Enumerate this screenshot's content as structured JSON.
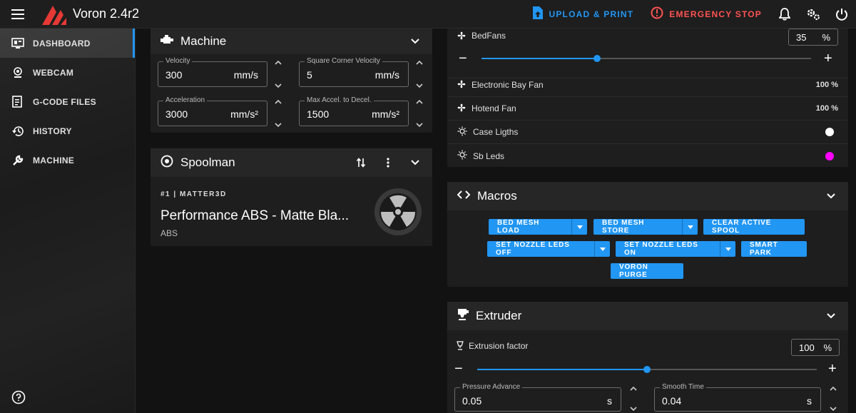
{
  "app": {
    "title": "Voron 2.4r2"
  },
  "topbar": {
    "upload_label": "UPLOAD & PRINT",
    "estop_label": "EMERGENCY STOP"
  },
  "sidebar": {
    "items": [
      {
        "label": "DASHBOARD",
        "icon": "monitor-dashboard-icon"
      },
      {
        "label": "WEBCAM",
        "icon": "webcam-icon"
      },
      {
        "label": "G-CODE FILES",
        "icon": "file-document-icon"
      },
      {
        "label": "HISTORY",
        "icon": "history-icon"
      },
      {
        "label": "MACHINE",
        "icon": "wrench-icon"
      }
    ]
  },
  "machine": {
    "title": "Machine",
    "velocity": {
      "label": "Velocity",
      "value": "300",
      "unit": "mm/s"
    },
    "scv": {
      "label": "Square Corner Velocity",
      "value": "5",
      "unit": "mm/s"
    },
    "accel": {
      "label": "Acceleration",
      "value": "3000",
      "unit": "mm/s²"
    },
    "decel": {
      "label": "Max Accel. to Decel.",
      "value": "1500",
      "unit": "mm/s²"
    }
  },
  "spoolman": {
    "title": "Spoolman",
    "spool_id": "#1 | MATTER3D",
    "spool_name": "Performance ABS - Matte Bla...",
    "material": "ABS"
  },
  "fans": {
    "bedfans": {
      "label": "BedFans",
      "value": "35",
      "unit": "%",
      "level": 0.35
    },
    "rows": [
      {
        "label": "Electronic Bay Fan",
        "value": "100 %"
      },
      {
        "label": "Hotend Fan",
        "value": "100 %"
      }
    ],
    "lights": [
      {
        "label": "Case Ligths",
        "color": "#ffffff"
      },
      {
        "label": "Sb Leds",
        "color": "#ff00ff"
      }
    ]
  },
  "macros": {
    "title": "Macros",
    "buttons": [
      {
        "label": "BED MESH LOAD"
      },
      {
        "label": "BED MESH STORE"
      },
      {
        "label": "CLEAR ACTIVE SPOOL"
      },
      {
        "label": "SET NOZZLE LEDS OFF"
      },
      {
        "label": "SET NOZZLE LEDS ON"
      },
      {
        "label": "SMART PARK"
      },
      {
        "label": "VORON PURGE"
      }
    ]
  },
  "extruder": {
    "title": "Extruder",
    "factor_label": "Extrusion factor",
    "factor_value": "100",
    "factor_unit": "%",
    "factor_level": 0.5,
    "pressure": {
      "label": "Pressure Advance",
      "value": "0.05",
      "unit": "s"
    },
    "smooth": {
      "label": "Smooth Time",
      "value": "0.04",
      "unit": "s"
    }
  },
  "colors": {
    "accent": "#2196f3",
    "estop": "#ff5252",
    "logo": "#e53935"
  }
}
